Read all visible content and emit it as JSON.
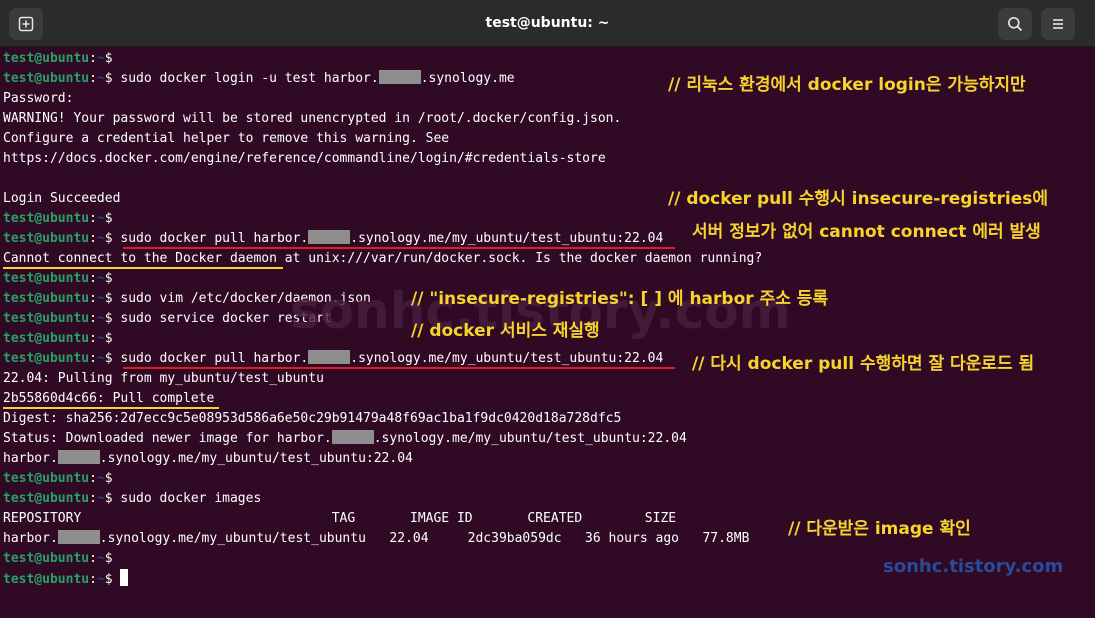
{
  "window": {
    "title": "test@ubuntu: ~"
  },
  "prompt": {
    "user_host": "test@ubuntu",
    "colon": ":",
    "path": "~",
    "symbol": "$"
  },
  "lines": [
    {
      "cmd": ""
    },
    {
      "cmd": "sudo docker login -u test harbor.",
      "cmd2": ".synology.me"
    },
    {
      "text": "Password:"
    },
    {
      "text": "WARNING! Your password will be stored unencrypted in /root/.docker/config.json."
    },
    {
      "text": "Configure a credential helper to remove this warning. See"
    },
    {
      "text": "https://docs.docker.com/engine/reference/commandline/login/#credentials-store"
    },
    {
      "text": ""
    },
    {
      "text": "Login Succeeded"
    },
    {
      "cmd": ""
    },
    {
      "cmd": "sudo docker pull harbor.",
      "cmd2": ".synology.me/my_ubuntu/test_ubuntu:22.04"
    },
    {
      "text": "Cannot connect to the Docker daemon at unix:///var/run/docker.sock. Is the docker daemon running?"
    },
    {
      "cmd": ""
    },
    {
      "cmd": "sudo vim /etc/docker/daemon.json"
    },
    {
      "cmd": "sudo service docker restart"
    },
    {
      "cmd": ""
    },
    {
      "cmd": "sudo docker pull harbor.",
      "cmd2": ".synology.me/my_ubuntu/test_ubuntu:22.04"
    },
    {
      "text": "22.04: Pulling from my_ubuntu/test_ubuntu"
    },
    {
      "text": "2b55860d4c66: Pull complete"
    },
    {
      "text": "Digest: sha256:2d7ecc9c5e08953d586a6e50c29b91479a48f69ac1ba1f9dc0420d18a728dfc5"
    },
    {
      "text": "Status: Downloaded newer image for harbor.",
      "text2": ".synology.me/my_ubuntu/test_ubuntu:22.04"
    },
    {
      "text": "harbor.",
      "text2": ".synology.me/my_ubuntu/test_ubuntu:22.04"
    },
    {
      "cmd": ""
    },
    {
      "cmd": "sudo docker images"
    },
    {
      "text": "REPOSITORY                                TAG       IMAGE ID       CREATED        SIZE"
    },
    {
      "text": "harbor.",
      "text2": ".synology.me/my_ubuntu/test_ubuntu   22.04     2dc39ba059dc   36 hours ago   77.8MB"
    },
    {
      "cmd": ""
    },
    {
      "cmd": ""
    }
  ],
  "annotations": [
    "// 리눅스 환경에서 docker login은 가능하지만",
    "// docker pull 수행시 insecure-registries에",
    "서버 정보가 없어 cannot connect 에러 발생",
    "// \"insecure-registries\": [ ] 에 harbor 주소 등록",
    "// docker 서비스 재실행",
    "// 다시 docker pull 수행하면 잘 다운로드 됨",
    "// 다운받은 image 확인"
  ],
  "watermarks": {
    "center": "sonhc.tistory.com",
    "corner": "sonhc.tistory.com"
  },
  "colors": {
    "background": "#300a24",
    "prompt_user": "#26a269",
    "prompt_path": "#12488b",
    "annotation": "#f6d32d",
    "underline_red": "#e01b24",
    "underline_yellow": "#f6d32d"
  },
  "icons": {
    "left": "new-tab-icon",
    "right1": "search-icon",
    "right2": "menu-icon"
  }
}
